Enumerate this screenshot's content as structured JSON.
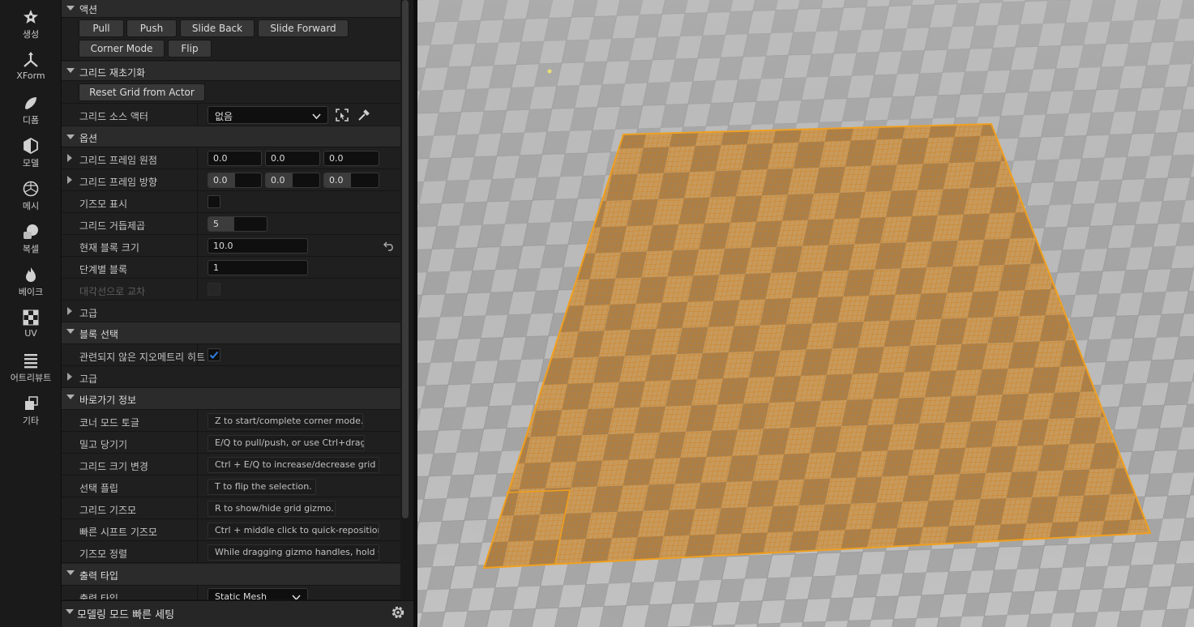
{
  "toolbar": {
    "items": [
      {
        "label": "생성",
        "icon": "create-icon"
      },
      {
        "label": "XForm",
        "icon": "xform-icon"
      },
      {
        "label": "디폼",
        "icon": "deform-icon"
      },
      {
        "label": "모델",
        "icon": "model-icon"
      },
      {
        "label": "메시",
        "icon": "mesh-icon"
      },
      {
        "label": "복셀",
        "icon": "voxel-icon"
      },
      {
        "label": "베이크",
        "icon": "bake-icon"
      },
      {
        "label": "UV",
        "icon": "uv-icon"
      },
      {
        "label": "어트리뷰트",
        "icon": "attributes-icon"
      },
      {
        "label": "기타",
        "icon": "misc-icon"
      }
    ]
  },
  "actions": {
    "title": "액션",
    "buttons": [
      "Pull",
      "Push",
      "Slide Back",
      "Slide Forward",
      "Corner Mode",
      "Flip"
    ]
  },
  "grid_reinit": {
    "title": "그리드 재초기화",
    "reset_button": "Reset Grid from Actor",
    "source_actor_label": "그리드 소스 액터",
    "source_actor_value": "없음"
  },
  "options": {
    "title": "옵션",
    "frame_origin_label": "그리드 프레임 원점",
    "frame_origin": [
      "0.0",
      "0.0",
      "0.0"
    ],
    "frame_orientation_label": "그리드 프레임 방향",
    "frame_orientation": [
      "0.0",
      "0.0",
      "0.0"
    ],
    "show_gizmo_label": "기즈모 표시",
    "show_gizmo": false,
    "grid_power_label": "그리드 거듭제곱",
    "grid_power": "5",
    "grid_power_fill": 0.45,
    "block_size_label": "현재 블록 크기",
    "block_size": "10.0",
    "blocks_per_step_label": "단계별 블록",
    "blocks_per_step": "1",
    "diagonal_label": "대각선으로 교차",
    "diagonal": false,
    "advanced_label": "고급"
  },
  "block_selection": {
    "title": "블록 선택",
    "hit_unrelated_label": "관련되지 않은 지오메트리 히트",
    "hit_unrelated": true,
    "advanced_label": "고급"
  },
  "shortcuts": {
    "title": "바로가기 정보",
    "rows": [
      {
        "label": "코너 모드 토글",
        "value": "Z to start/complete corner mode."
      },
      {
        "label": "밀고 당기기",
        "value": "E/Q to pull/push, or use Ctrl+drag."
      },
      {
        "label": "그리드 크기 변경",
        "value": "Ctrl + E/Q to increase/decrease grid s"
      },
      {
        "label": "선택 플립",
        "value": "T to flip the selection."
      },
      {
        "label": "그리드 기즈모",
        "value": "R to show/hide grid gizmo."
      },
      {
        "label": "빠른 시프트 기즈모",
        "value": "Ctrl + middle click to quick-reposition"
      },
      {
        "label": "기즈모 정렬",
        "value": "While dragging gizmo handles, hold Ct"
      }
    ]
  },
  "output": {
    "title": "출력 타입",
    "type_label": "출력 타입",
    "type_value": "Static Mesh"
  },
  "footer": {
    "title": "모델링 모드 빠른 세팅"
  },
  "colors": {
    "accent": "#f0a020",
    "checkbox_on": "#2f7de1",
    "panel_bg": "#1f1f1f"
  }
}
